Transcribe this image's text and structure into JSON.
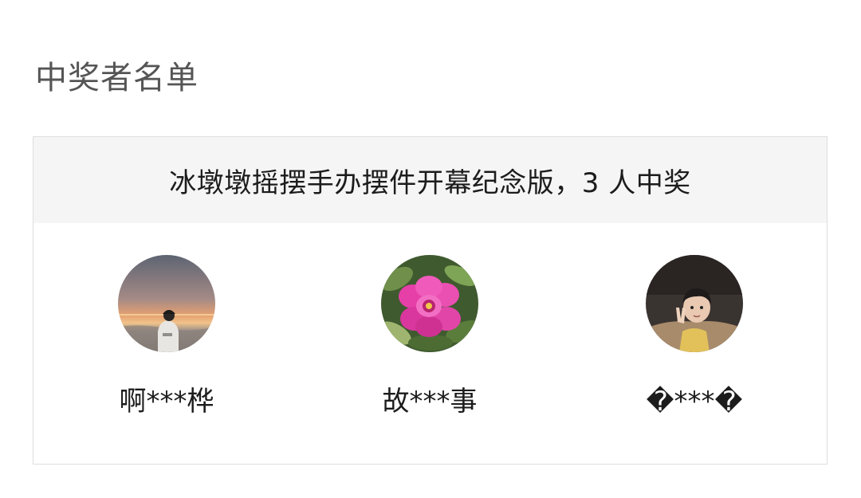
{
  "page": {
    "title": "中奖者名单"
  },
  "prize": {
    "header": "冰墩墩摇摆手办摆件开幕纪念版，3 人中奖"
  },
  "winners": [
    {
      "name": "啊***桦",
      "avatar": "sunset-beach-photo"
    },
    {
      "name": "故***事",
      "avatar": "pink-peony-photo"
    },
    {
      "name": "�***�",
      "avatar": "child-photo"
    }
  ]
}
